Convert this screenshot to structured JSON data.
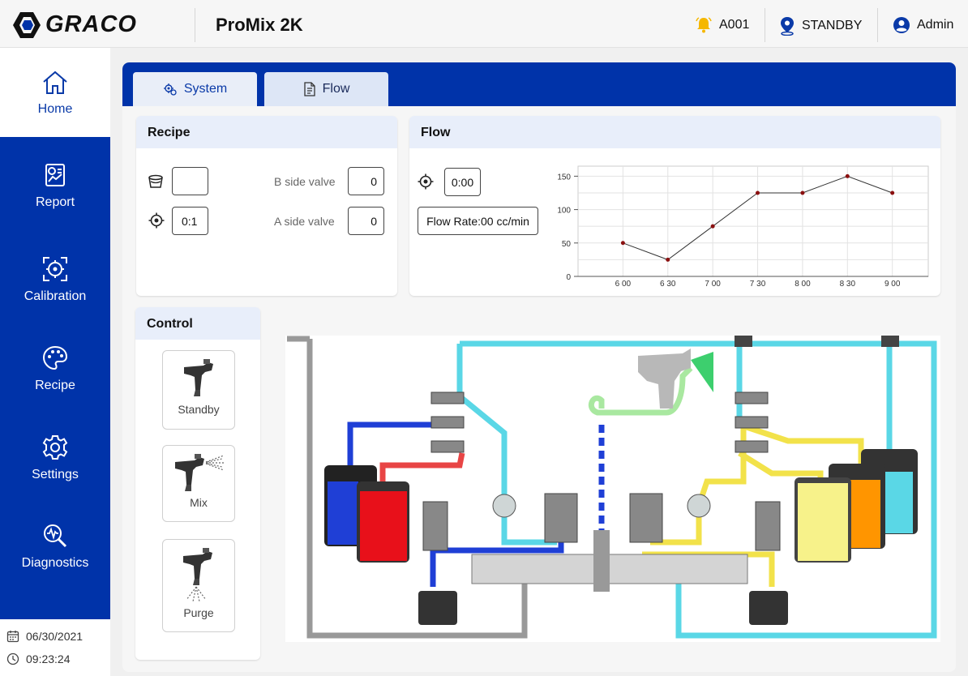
{
  "header": {
    "logo_text": "GRACO",
    "app_title": "ProMix 2K",
    "alarm": "A001",
    "status": "STANDBY",
    "user": "Admin"
  },
  "sidebar": {
    "items": [
      {
        "label": "Home",
        "icon": "home-icon"
      },
      {
        "label": "Report",
        "icon": "report-icon"
      },
      {
        "label": "Calibration",
        "icon": "calibration-icon"
      },
      {
        "label": "Recipe",
        "icon": "recipe-icon"
      },
      {
        "label": "Settings",
        "icon": "gear-icon"
      },
      {
        "label": "Diagnostics",
        "icon": "diagnostics-icon"
      }
    ],
    "date": "06/30/2021",
    "time": "09:23:24"
  },
  "tabs": [
    {
      "label": "System",
      "active": true
    },
    {
      "label": "Flow",
      "active": false
    }
  ],
  "recipe_panel": {
    "title": "Recipe",
    "recipe_value": "",
    "ratio_value": "0:1",
    "b_side_label": "B side valve",
    "b_side_value": "0",
    "a_side_label": "A side valve",
    "a_side_value": "0"
  },
  "flow_panel": {
    "title": "Flow",
    "timer_value": "0:00",
    "flow_rate": "Flow Rate:00 cc/min"
  },
  "chart_data": {
    "type": "line",
    "x": [
      "6 00",
      "6 30",
      "7 00",
      "7 30",
      "8 00",
      "8 30",
      "9 00"
    ],
    "values": [
      50,
      25,
      75,
      125,
      125,
      150,
      125
    ],
    "ylim": [
      0,
      165
    ],
    "yticks": [
      "0",
      "50",
      "100",
      "150"
    ],
    "grid": true
  },
  "control_panel": {
    "title": "Control",
    "buttons": [
      {
        "label": "Standby"
      },
      {
        "label": "Mix"
      },
      {
        "label": "Purge"
      }
    ]
  },
  "colors": {
    "brand_blue": "#0033a9",
    "panel_header": "#e8eefa",
    "line": "#333333",
    "marker": "#8b1010"
  }
}
